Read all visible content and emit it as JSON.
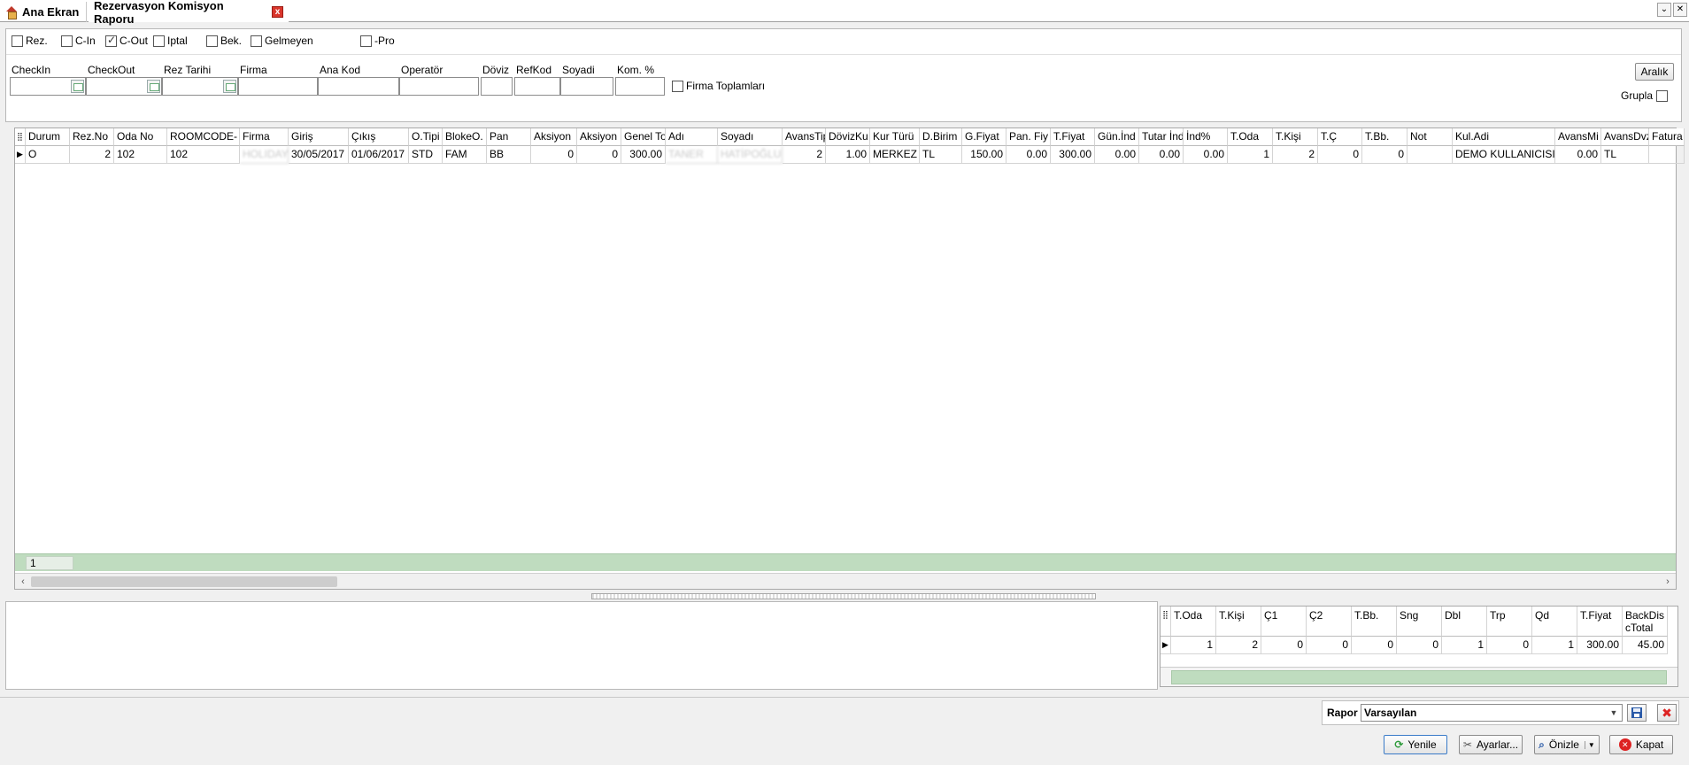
{
  "tabs": {
    "home": "Ana Ekran",
    "report": "Rezervasyon Komisyon Raporu"
  },
  "status_filters": [
    {
      "label": "Rez.",
      "checked": false
    },
    {
      "label": "C-In",
      "checked": false
    },
    {
      "label": "C-Out",
      "checked": true
    },
    {
      "label": "Iptal",
      "checked": false
    },
    {
      "label": "Bek.",
      "checked": false
    },
    {
      "label": "Gelmeyen",
      "checked": false
    },
    {
      "label": "-Pro",
      "checked": false
    }
  ],
  "filters": {
    "checkin": "CheckIn",
    "checkout": "CheckOut",
    "rez_tarihi": "Rez Tarihi",
    "firma": "Firma",
    "ana_kod": "Ana Kod",
    "operator": "Operatör",
    "doviz": "Döviz",
    "refkod": "RefKod",
    "soyadi": "Soyadi",
    "kom": "Kom. %",
    "firma_toplamlari": "Firma Toplamları",
    "aralik": "Aralık",
    "grupla": "Grupla"
  },
  "grid": {
    "columns": [
      "Durum",
      "Rez.No",
      "Oda No",
      "ROOMCODE-",
      "Firma",
      "Giriş",
      "Çıkış",
      "O.Tipi",
      "BlokeO.",
      "Pan",
      "Aksiyon",
      "Aksiyon",
      "Genel To",
      "Adı",
      "Soyadı",
      "AvansTip",
      "DövizKu",
      "Kur Türü",
      "D.Birim",
      "G.Fiyat",
      "Pan. Fiy",
      "T.Fiyat",
      "Gün.İnd",
      "Tutar İnd",
      "İnd%",
      "T.Oda",
      "T.Kişi",
      "T.Ç",
      "T.Bb.",
      "Not",
      "Kul.Adi",
      "AvansMi",
      "AvansDvz",
      "Fatura"
    ],
    "rows": [
      [
        "O",
        "2",
        "102",
        "102",
        "HOLIDAY",
        "30/05/2017",
        "01/06/2017",
        "STD",
        "FAM",
        "BB",
        "0",
        "0",
        "300.00",
        "TANER",
        "HATİPOĞLU",
        "2",
        "1.00",
        "MERKEZ",
        "TL",
        "150.00",
        "0.00",
        "300.00",
        "0.00",
        "0.00",
        "0.00",
        "1",
        "2",
        "0",
        "0",
        "",
        "DEMO KULLANICISI",
        "0.00",
        "TL",
        ""
      ]
    ],
    "footer_count": "1"
  },
  "summary": {
    "columns": [
      "T.Oda",
      "T.Kişi",
      "Ç1",
      "Ç2",
      "T.Bb.",
      "Sng",
      "Dbl",
      "Trp",
      "Qd",
      "T.Fiyat",
      "BackDiscTotal"
    ],
    "rows": [
      [
        "1",
        "2",
        "0",
        "0",
        "0",
        "0",
        "1",
        "0",
        "1",
        "300.00",
        "45.00"
      ]
    ]
  },
  "rapor": {
    "label": "Rapor",
    "selected": "Varsayılan"
  },
  "buttons": {
    "yenile": "Yenile",
    "ayarlar": "Ayarlar...",
    "onizle": "Önizle",
    "kapat": "Kapat"
  }
}
